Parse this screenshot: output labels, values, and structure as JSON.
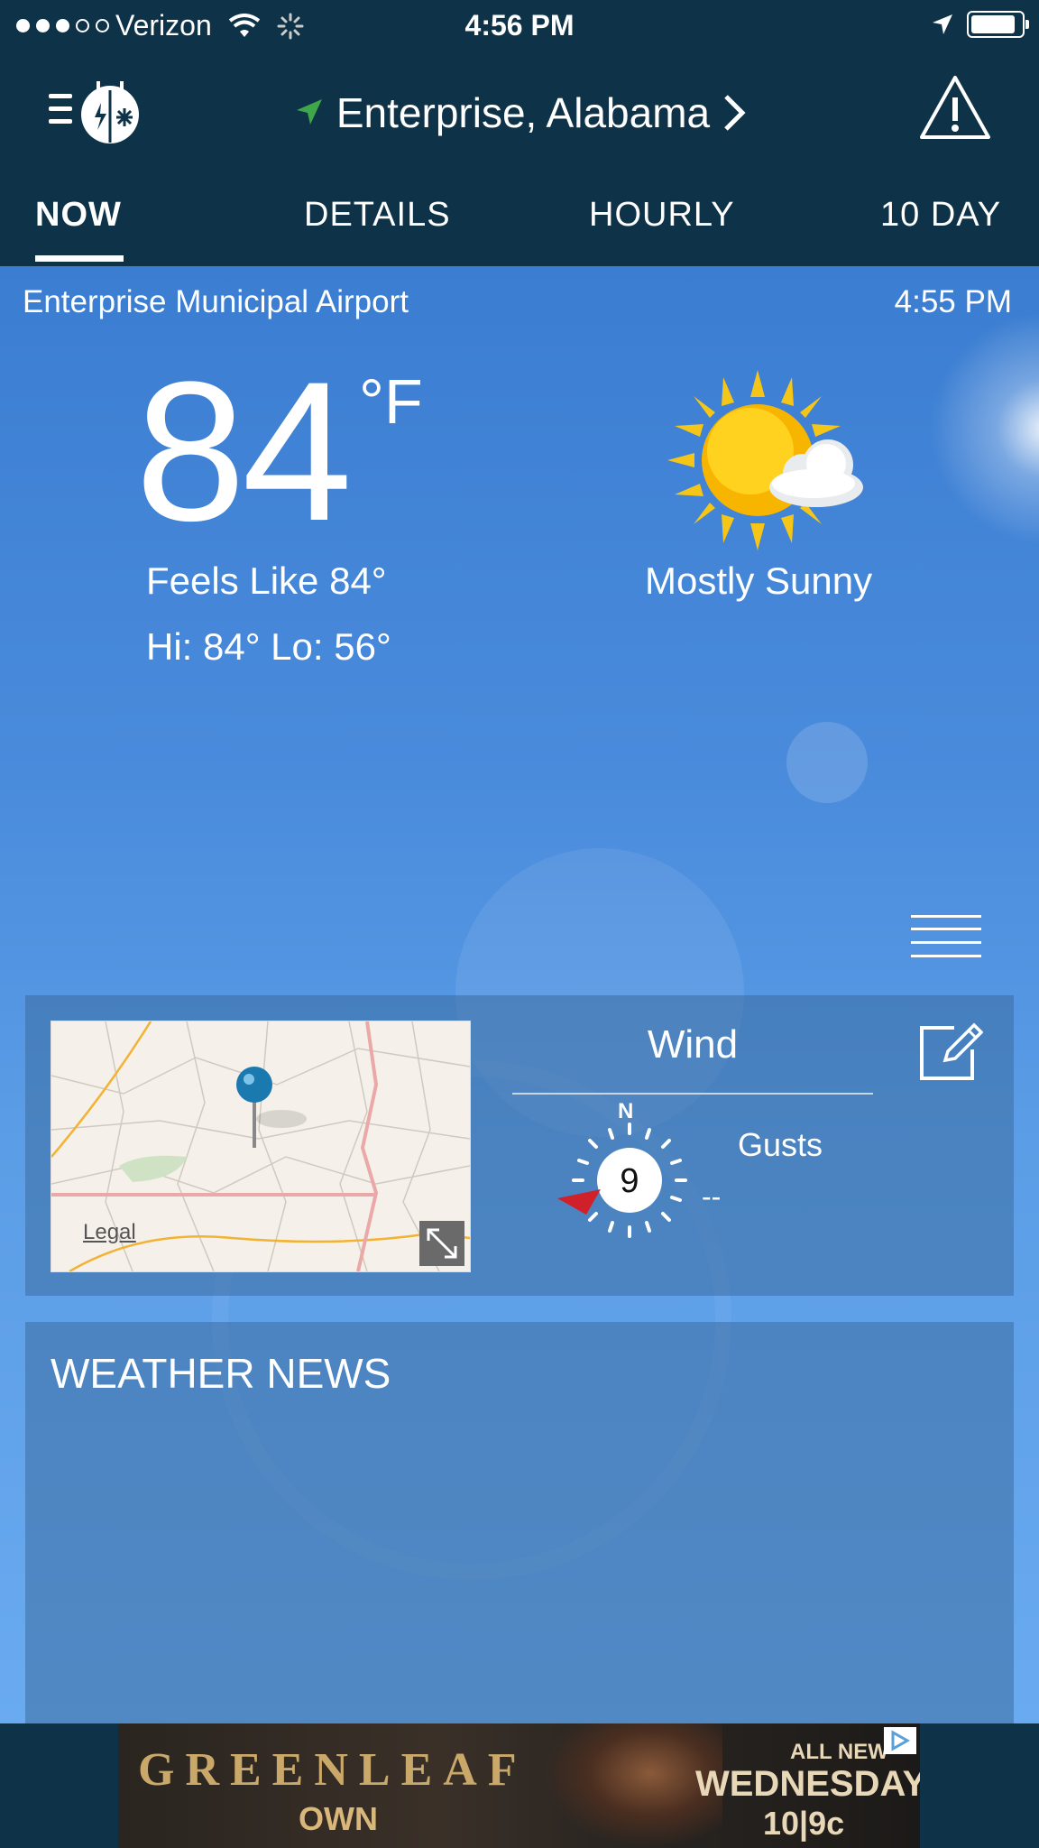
{
  "status": {
    "carrier": "Verizon",
    "time": "4:56 PM"
  },
  "header": {
    "location": "Enterprise,  Alabama"
  },
  "tabs": [
    {
      "label": "NOW",
      "active": true
    },
    {
      "label": "DETAILS"
    },
    {
      "label": "HOURLY"
    },
    {
      "label": "10  DAY"
    }
  ],
  "current": {
    "station": "Enterprise  Municipal  Airport",
    "obs_time": "4:55  PM",
    "temp": "84",
    "unit": "°F",
    "feels_like": "Feels  Like  84°",
    "hi_lo": "Hi: 84°  Lo: 56°",
    "condition": "Mostly  Sunny",
    "condition_icon": "sun-cloud-icon"
  },
  "wind_card": {
    "map_legal": "Legal",
    "title": "Wind",
    "speed": "9",
    "compass_n": "N",
    "gusts_label": "Gusts",
    "gusts_value": "--"
  },
  "news": {
    "title": "WEATHER  NEWS"
  },
  "ad": {
    "brand": "GREENLEAF",
    "network": "OWN",
    "promo_line1": "ALL NEW",
    "promo_line2": "WEDNESDAYS",
    "promo_line3": "10|9c"
  },
  "colors": {
    "topbar": "#0e3247",
    "accent_green": "#3fa64a",
    "wind_arrow": "#d0202a"
  }
}
